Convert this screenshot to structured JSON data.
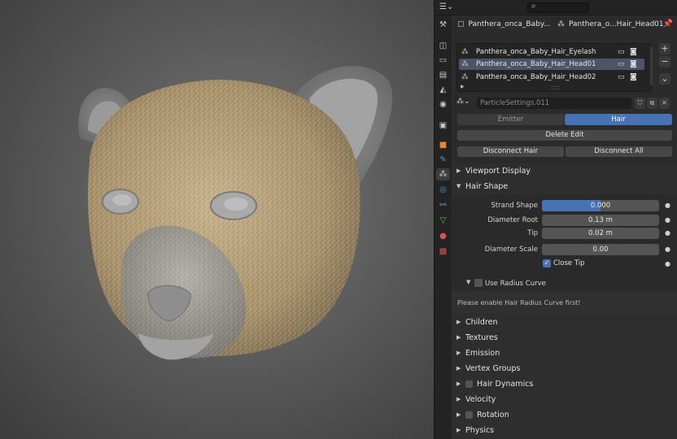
{
  "viewport": {
    "description_colors": {
      "fur": "#b8a27a",
      "skin": "#9a9a9a",
      "background": "#5c5c5c"
    }
  },
  "topbar": {
    "editor_icon": "properties-editor-icon",
    "search_icon": "⌕"
  },
  "tabs": [
    {
      "name": "tool-tab",
      "glyph": "⚒"
    },
    {
      "name": "render-tab",
      "glyph": "📷"
    },
    {
      "name": "output-tab",
      "glyph": "🖶"
    },
    {
      "name": "view-layer-tab",
      "glyph": "▤"
    },
    {
      "name": "scene-tab",
      "glyph": "◭"
    },
    {
      "name": "world-tab",
      "glyph": "◉"
    },
    {
      "name": "collection-tab",
      "glyph": "▣"
    },
    {
      "name": "object-tab",
      "glyph": "■"
    },
    {
      "name": "modifier-tab",
      "glyph": "🔧"
    },
    {
      "name": "particles-tab",
      "glyph": "⁂"
    },
    {
      "name": "physics-tab",
      "glyph": "◎"
    },
    {
      "name": "constraints-tab",
      "glyph": "⛓"
    },
    {
      "name": "data-tab",
      "glyph": "▽"
    },
    {
      "name": "material-tab",
      "glyph": "●"
    },
    {
      "name": "texture-tab",
      "glyph": "▩"
    }
  ],
  "header": {
    "object_name": "Panthera_onca_Baby...",
    "particle_system_name": "Panthera_o...Hair_Head01"
  },
  "particle_list": {
    "items": [
      {
        "label": "Panthera_onca_Baby_Hair_Eyelash",
        "selected": false
      },
      {
        "label": "Panthera_onca_Baby_Hair_Head01",
        "selected": true
      },
      {
        "label": "Panthera_onca_Baby_Hair_Head02",
        "selected": false
      }
    ],
    "add_label": "+",
    "remove_label": "−",
    "menu_label": "⌄",
    "grip": "::::"
  },
  "settings": {
    "name": "ParticleSettings.011"
  },
  "type_toggle": {
    "emitter_label": "Emitter",
    "hair_label": "Hair",
    "active": "Hair"
  },
  "buttons": {
    "delete_edit": "Delete Edit",
    "disconnect_hair": "Disconnect Hair",
    "disconnect_all": "Disconnect All"
  },
  "panels": {
    "viewport_display": "Viewport Display",
    "hair_shape": "Hair Shape",
    "children": "Children",
    "textures": "Textures",
    "emission": "Emission",
    "vertex_groups": "Vertex Groups",
    "hair_dynamics": "Hair Dynamics",
    "velocity": "Velocity",
    "rotation": "Rotation",
    "physics": "Physics"
  },
  "hair_shape": {
    "strand_shape_label": "Strand Shape",
    "strand_shape_value": "0.000",
    "strand_shape_fill": 0.5,
    "diameter_root_label": "Diameter Root",
    "diameter_root_value": "0.13 m",
    "tip_label": "Tip",
    "tip_value": "0.02 m",
    "diameter_scale_label": "Diameter Scale",
    "diameter_scale_value": "0.00",
    "close_tip_label": "Close Tip",
    "close_tip_checked": true,
    "use_radius_curve_label": "Use Radius Curve",
    "message": "Please enable Hair Radius Curve first!"
  },
  "colors": {
    "accent": "#4772b3",
    "panel_bg": "#2b2b2b",
    "field_bg": "#545454"
  }
}
